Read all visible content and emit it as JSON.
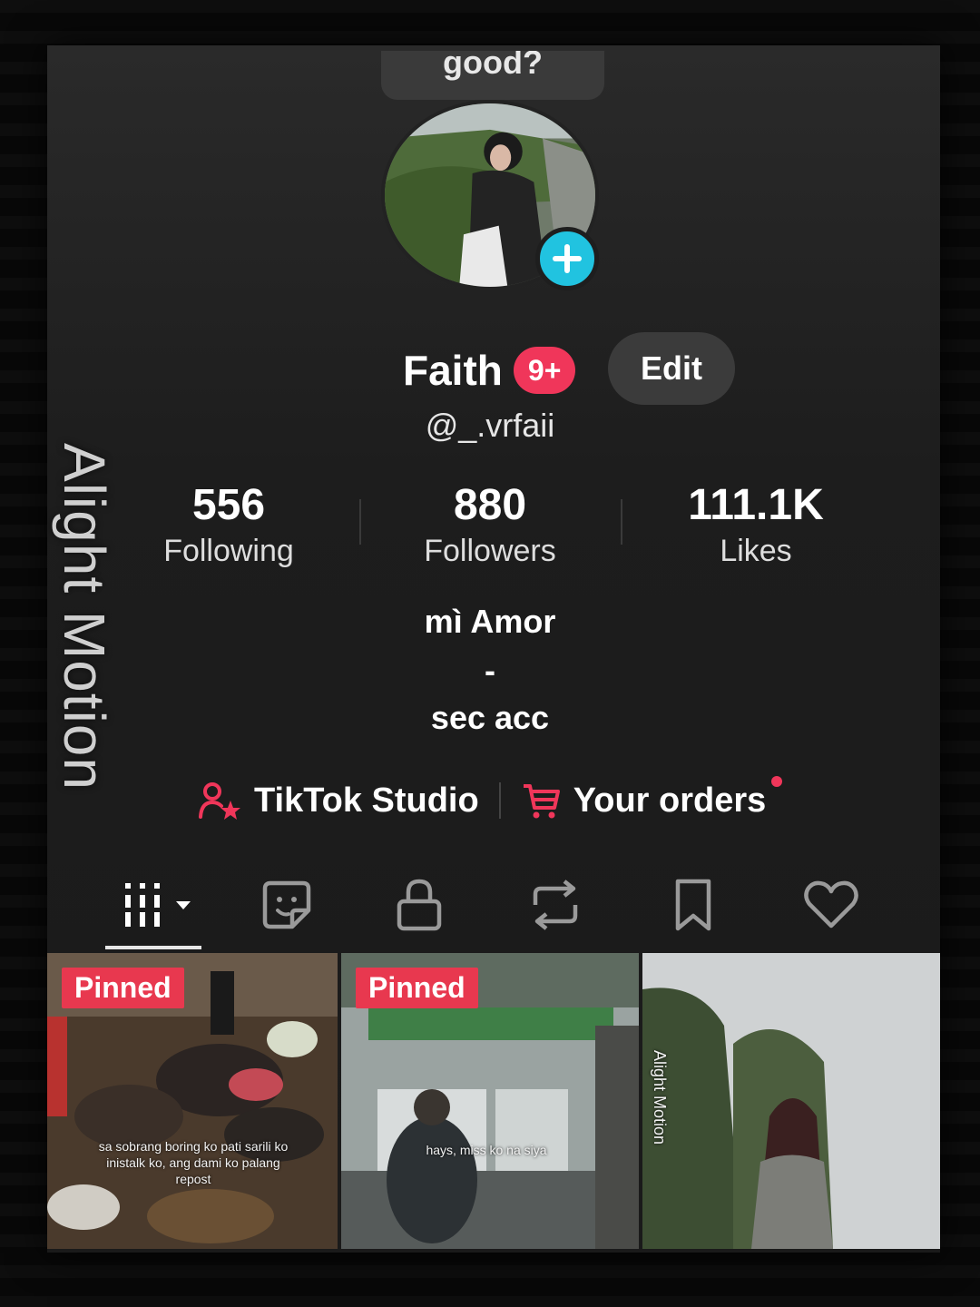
{
  "note": {
    "text": "good?"
  },
  "profile": {
    "name": "Faith",
    "badge": "9+",
    "edit_label": "Edit",
    "username": "@_.vrfaii"
  },
  "stats": [
    {
      "value": "556",
      "label": "Following"
    },
    {
      "value": "880",
      "label": "Followers"
    },
    {
      "value": "111.1K",
      "label": "Likes"
    }
  ],
  "bio": {
    "line1": "mì Amor",
    "line2": "-",
    "line3": "sec acc"
  },
  "links": {
    "studio": "TikTok Studio",
    "orders": "Your orders"
  },
  "tabs": [
    "videos-grid-icon",
    "story-sticker-icon",
    "lock-icon",
    "repost-icon",
    "bookmark-icon",
    "heart-icon"
  ],
  "watermark": "Alight Motion",
  "videos": [
    {
      "pinned_label": "Pinned",
      "caption": "sa sobrang boring ko pati sarili ko inistalk ko, ang dami ko palang repost"
    },
    {
      "pinned_label": "Pinned",
      "caption": "hays, miss ko na siya"
    },
    {
      "watermark": "Alight Motion"
    }
  ],
  "colors": {
    "accent": "#f0365a",
    "add_button": "#21c3e0",
    "background": "#1d1d1d"
  }
}
